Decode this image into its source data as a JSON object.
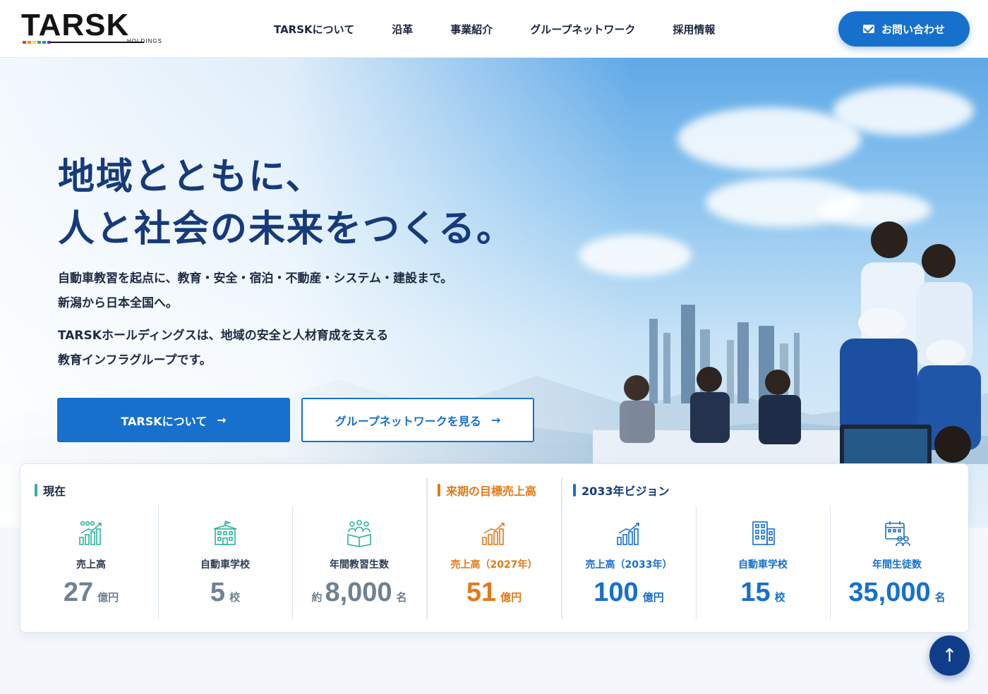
{
  "header": {
    "logo_text": "TARSK",
    "logo_sub": "HOLDINGS",
    "logo_colors": [
      "#e53935",
      "#fb8c00",
      "#fdd835",
      "#43a047",
      "#1e88e5",
      "#8e24aa"
    ],
    "nav": [
      {
        "label": "TARSKについて"
      },
      {
        "label": "沿革"
      },
      {
        "label": "事業紹介"
      },
      {
        "label": "グループネットワーク"
      },
      {
        "label": "採用情報"
      }
    ],
    "contact_label": "お問い合わせ",
    "contact_icon": "mail-icon"
  },
  "hero": {
    "headline_line1": "地域とともに、",
    "headline_line2": "人と社会の未来をつくる。",
    "lead_line1": "自動車教習を起点に、教育・安全・宿泊・不動産・システム・建設まで。",
    "lead_line2": "新潟から日本全国へ。",
    "lead_line3": "TARSKホールディングスは、地域の安全と人材育成を支える",
    "lead_line4": "教育インフラグループです。",
    "primary_button": "TARSKについて",
    "secondary_button": "グループネットワークを見る",
    "arrow": "→"
  },
  "stats": {
    "groups": [
      {
        "label": "現在",
        "color": "#2bb3a0"
      },
      {
        "label": "来期の目標売上高",
        "color": "#e17a1a"
      },
      {
        "label": "2033年ビジョン",
        "color": "#1670cc"
      }
    ],
    "items": [
      {
        "label": "売上高",
        "prefix": "",
        "value": "27",
        "unit": "億円",
        "tone": "gray",
        "icon": "growth-chart-icon"
      },
      {
        "label": "自動車学校",
        "prefix": "",
        "value": "5",
        "unit": "校",
        "tone": "gray",
        "icon": "school-building-icon"
      },
      {
        "label": "年間教習生数",
        "prefix": "約",
        "value": "8,000",
        "unit": "名",
        "tone": "gray",
        "icon": "students-book-icon"
      },
      {
        "label": "売上高（2027年）",
        "prefix": "",
        "value": "51",
        "unit": "億円",
        "tone": "orange",
        "icon": "growth-chart-icon"
      },
      {
        "label": "売上高（2033年）",
        "prefix": "",
        "value": "100",
        "unit": "億円",
        "tone": "blue",
        "icon": "growth-chart-icon"
      },
      {
        "label": "自動車学校",
        "prefix": "",
        "value": "15",
        "unit": "校",
        "tone": "blue",
        "icon": "office-building-icon"
      },
      {
        "label": "年間生徒数",
        "prefix": "",
        "value": "35,000",
        "unit": "名",
        "tone": "blue",
        "icon": "calendar-people-icon"
      }
    ]
  },
  "to_top_label": "↑"
}
